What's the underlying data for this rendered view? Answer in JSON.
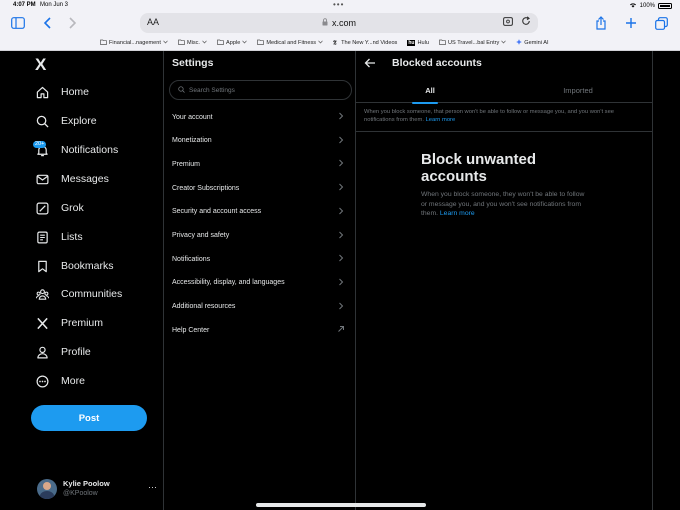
{
  "status_bar": {
    "time": "4:07 PM",
    "date": "Mon Jun 3",
    "battery": "100%"
  },
  "browser": {
    "text_size_label": "AA",
    "url": "x.com",
    "bookmarks": [
      {
        "label": "Financial...nagement",
        "icon": "folder-icon",
        "has_chevron": true
      },
      {
        "label": "Misc.",
        "icon": "folder-icon",
        "has_chevron": true
      },
      {
        "label": "Apple",
        "icon": "folder-icon",
        "has_chevron": true
      },
      {
        "label": "Medical and Fitness",
        "icon": "folder-icon",
        "has_chevron": true
      },
      {
        "label": "The New Y...nd Videos",
        "icon": "nyt-icon",
        "has_chevron": false
      },
      {
        "label": "Hulu",
        "icon": "hulu-icon",
        "has_chevron": false
      },
      {
        "label": "US Travel...bal Entry",
        "icon": "folder-icon",
        "has_chevron": true
      },
      {
        "label": "Gemini AI",
        "icon": "gemini-icon",
        "has_chevron": false
      }
    ]
  },
  "nav": {
    "logo": "X",
    "items": [
      {
        "label": "Home",
        "icon": "home-icon"
      },
      {
        "label": "Explore",
        "icon": "search-icon"
      },
      {
        "label": "Notifications",
        "icon": "bell-icon",
        "badge": "20+"
      },
      {
        "label": "Messages",
        "icon": "mail-icon"
      },
      {
        "label": "Grok",
        "icon": "grok-icon"
      },
      {
        "label": "Lists",
        "icon": "list-icon"
      },
      {
        "label": "Bookmarks",
        "icon": "bookmark-icon"
      },
      {
        "label": "Communities",
        "icon": "communities-icon"
      },
      {
        "label": "Premium",
        "icon": "x-logo-icon"
      },
      {
        "label": "Profile",
        "icon": "person-icon"
      },
      {
        "label": "More",
        "icon": "more-circle-icon"
      }
    ],
    "post_button": "Post",
    "profile": {
      "name": "Kylie Poolow",
      "handle": "@KPoolow"
    }
  },
  "settings": {
    "title": "Settings",
    "search_placeholder": "Search Settings",
    "items": [
      {
        "label": "Your account",
        "icon": "chevron-right-icon"
      },
      {
        "label": "Monetization",
        "icon": "chevron-right-icon"
      },
      {
        "label": "Premium",
        "icon": "chevron-right-icon"
      },
      {
        "label": "Creator Subscriptions",
        "icon": "chevron-right-icon"
      },
      {
        "label": "Security and account access",
        "icon": "chevron-right-icon"
      },
      {
        "label": "Privacy and safety",
        "icon": "chevron-right-icon"
      },
      {
        "label": "Notifications",
        "icon": "chevron-right-icon"
      },
      {
        "label": "Accessibility, display, and languages",
        "icon": "chevron-right-icon"
      },
      {
        "label": "Additional resources",
        "icon": "chevron-right-icon"
      },
      {
        "label": "Help Center",
        "icon": "external-link-icon"
      }
    ]
  },
  "blocked": {
    "title": "Blocked accounts",
    "tabs": [
      {
        "label": "All",
        "active": true
      },
      {
        "label": "Imported",
        "active": false
      }
    ],
    "info_text": "When you block someone, that person won't be able to follow or message you, and you won't see notifications from them.",
    "info_link": "Learn more",
    "empty_title": "Block unwanted accounts",
    "empty_body": "When you block someone, they won't be able to follow or message you, and you won't see notifications from them.",
    "empty_link": "Learn more"
  },
  "colors": {
    "accent": "#1d9bf0",
    "background": "#000000",
    "border": "#2f3336",
    "muted_text": "#71767b",
    "text": "#e7e9ea",
    "safari_blue": "#1a73e8"
  }
}
